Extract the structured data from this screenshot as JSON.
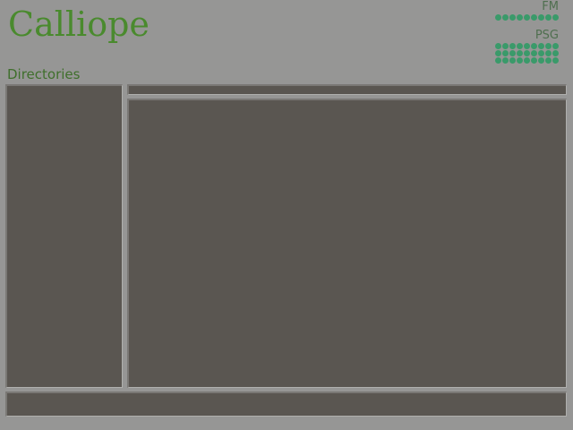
{
  "app": {
    "title": "Calliope"
  },
  "meters": {
    "fm": {
      "label": "FM",
      "rows": 1,
      "leds_per_row": 9,
      "level": 1.0
    },
    "psg": {
      "label": "PSG",
      "rows": 3,
      "leds_per_row": 9,
      "level": 1.0
    }
  },
  "sidebar": {
    "heading": "Directories",
    "items": []
  },
  "path_bar": {
    "value": ""
  },
  "file_list": {
    "items": []
  },
  "status_bar": {
    "text": ""
  },
  "colors": {
    "background": "#969695",
    "panel": "#5a5651",
    "title": "#4a8a2e",
    "heading": "#3f6f2c",
    "meter_led": "#3a9a6a",
    "meter_label": "#4f6f4f"
  }
}
